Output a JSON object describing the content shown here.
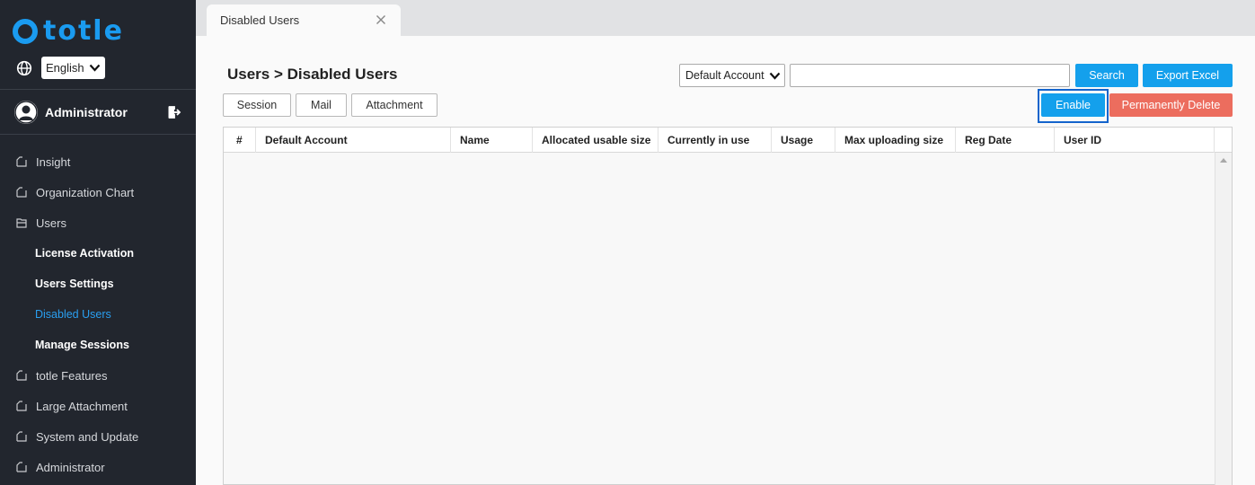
{
  "brand": {
    "logo_text": "totle",
    "accent": "#1a9bf0"
  },
  "language": {
    "selected": "English"
  },
  "user": {
    "name": "Administrator"
  },
  "nav": {
    "items": [
      {
        "label": "Insight",
        "type": "top"
      },
      {
        "label": "Organization Chart",
        "type": "top"
      },
      {
        "label": "Users",
        "type": "top",
        "open": true
      },
      {
        "label": "License Activation",
        "type": "sub"
      },
      {
        "label": "Users Settings",
        "type": "sub"
      },
      {
        "label": "Disabled Users",
        "type": "sub",
        "active": true
      },
      {
        "label": "Manage Sessions",
        "type": "sub"
      },
      {
        "label": "totle Features",
        "type": "top"
      },
      {
        "label": "Large Attachment",
        "type": "top"
      },
      {
        "label": "System and Update",
        "type": "top"
      },
      {
        "label": "Administrator",
        "type": "top"
      }
    ]
  },
  "tab": {
    "label": "Disabled Users"
  },
  "page": {
    "title": "Users > Disabled Users"
  },
  "toolbar": {
    "account_select": "Default Account",
    "search_value": "",
    "search_label": "Search",
    "export_label": "Export Excel",
    "enable_label": "Enable",
    "delete_label": "Permanently Delete"
  },
  "subtabs": [
    "Session",
    "Mail",
    "Attachment"
  ],
  "table": {
    "columns": [
      "#",
      "Default Account",
      "Name",
      "Allocated usable size",
      "Currently in use",
      "Usage",
      "Max uploading size",
      "Reg Date",
      "User ID"
    ],
    "rows": []
  },
  "colors": {
    "primary_button": "#14a0ec",
    "danger_button": "#ec6d5e",
    "active_nav": "#2a9ff0",
    "sidebar_bg": "#22262e"
  }
}
